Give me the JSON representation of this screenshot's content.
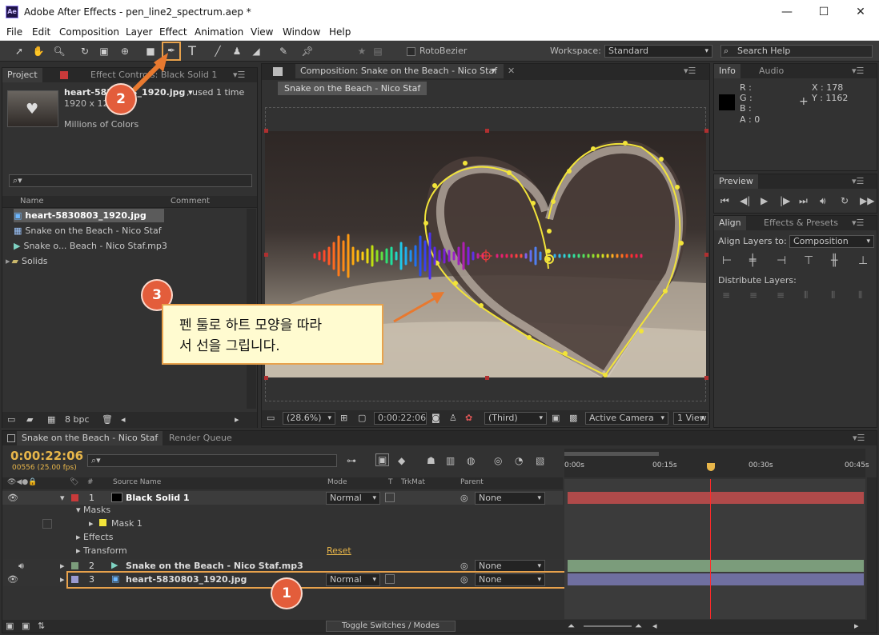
{
  "window": {
    "title": "Adobe After Effects - pen_line2_spectrum.aep *",
    "app_icon": "Ae",
    "min": "—",
    "max": "☐",
    "close": "✕"
  },
  "menu": [
    "File",
    "Edit",
    "Composition",
    "Layer",
    "Effect",
    "Animation",
    "View",
    "Window",
    "Help"
  ],
  "toolbar": {
    "rotobezier": "RotoBezier",
    "workspace_label": "Workspace:",
    "workspace_value": "Standard",
    "search_placeholder": "Search Help"
  },
  "project": {
    "tab": "Project",
    "effect_controls_tab": "Effect Controls: Black Solid 1",
    "asset_name": "heart-5830803_1920.jpg ▾",
    "asset_used": ", used 1 time",
    "asset_dims": "1920 x 1280",
    "asset_colors": "Millions of Colors",
    "col_name": "Name",
    "col_comment": "Comment",
    "items": [
      "heart-5830803_1920.jpg",
      "Snake on the Beach - Nico Staf",
      "Snake o... Beach - Nico Staf.mp3",
      "Solids"
    ],
    "bpc": "8 bpc"
  },
  "composition": {
    "tab": "Composition: Snake on the Beach - Nico Staf",
    "sub_tab": "Snake on the Beach - Nico Staf",
    "zoom": "(28.6%)",
    "timecode": "0:00:22:06",
    "resolution": "(Third)",
    "camera": "Active Camera",
    "view": "1 View"
  },
  "info": {
    "tab": "Info",
    "audio_tab": "Audio",
    "r": "R :",
    "g": "G :",
    "b": "B :",
    "a": "A : 0",
    "x": "X : 178",
    "y": "Y : 1162"
  },
  "preview": {
    "tab": "Preview"
  },
  "align": {
    "tab": "Align",
    "effects_tab": "Effects & Presets",
    "align_to_label": "Align Layers to:",
    "align_to_value": "Composition",
    "distribute_label": "Distribute Layers:"
  },
  "timeline": {
    "tab": "Snake on the Beach - Nico Staf",
    "render_tab": "Render Queue",
    "timecode": "0:00:22:06",
    "fps": "00556 (25.00 fps)",
    "ruler": [
      "0:00s",
      "00:15s",
      "00:30s",
      "00:45s"
    ],
    "col_num": "#",
    "col_source": "Source Name",
    "col_mode": "Mode",
    "col_t": "T",
    "col_trkmat": "TrkMat",
    "col_parent": "Parent",
    "toggle": "Toggle Switches / Modes",
    "layers": [
      {
        "num": "1",
        "name": "Black Solid 1",
        "mode": "Normal",
        "parent": "None"
      },
      {
        "num": "2",
        "name": "Snake on the Beach - Nico Staf.mp3",
        "parent": "None"
      },
      {
        "num": "3",
        "name": "heart-5830803_1920.jpg",
        "mode": "Normal",
        "parent": "None"
      }
    ],
    "masks": "Masks",
    "mask1": "Mask 1",
    "effects": "Effects",
    "transform": "Transform",
    "reset": "Reset"
  },
  "annotations": {
    "b1": "1",
    "b2": "2",
    "b3": "3",
    "callout_line1": "펜 툴로 하트 모양을 따라",
    "callout_line2": "서 선을 그립니다."
  },
  "colors": {
    "accent_orange": "#e8a24c",
    "badge": "#e35d3b",
    "timecode": "#e8b64a",
    "solid_bar": "#b04a4a",
    "audio_bar": "#7b9c7b",
    "image_bar": "#6f6fa0",
    "mask_path": "#f2e43a"
  }
}
